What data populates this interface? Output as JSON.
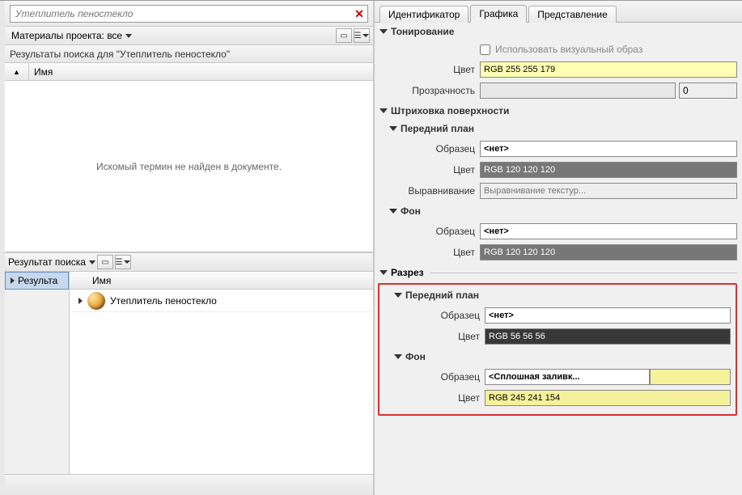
{
  "search": {
    "placeholder": "Утеплитель пеностекло"
  },
  "filter": {
    "label": "Материалы проекта: все"
  },
  "resultsFor": "Результаты поиска для \"Утеплитель пеностекло\"",
  "colName": "Имя",
  "notFound": "Искомый термин не найден в документе.",
  "resultSearch": "Результат поиска",
  "leftTabs": {
    "results": "Результа"
  },
  "listItem": "Утеплитель пеностекло",
  "rtabs": {
    "id": "Идентификатор",
    "gfx": "Графика",
    "view": "Представление"
  },
  "sect": {
    "tint": "Тонирование",
    "useVisual": "Использовать визуальный образ",
    "surface": "Штриховка поверхности",
    "foreground": "Передний план",
    "background": "Фон",
    "cut": "Разрез"
  },
  "lbl": {
    "color": "Цвет",
    "transparency": "Прозрачность",
    "pattern": "Образец",
    "align": "Выравнивание"
  },
  "vals": {
    "tintColor": "RGB 255 255 179",
    "trans": "0",
    "none": "<нет>",
    "grey120": "RGB 120 120 120",
    "alignTex": "Выравнивание текстур...",
    "rgb56": "RGB 56 56 56",
    "solidFill": "<Сплошная заливк...",
    "rgb245": "RGB 245 241 154"
  }
}
